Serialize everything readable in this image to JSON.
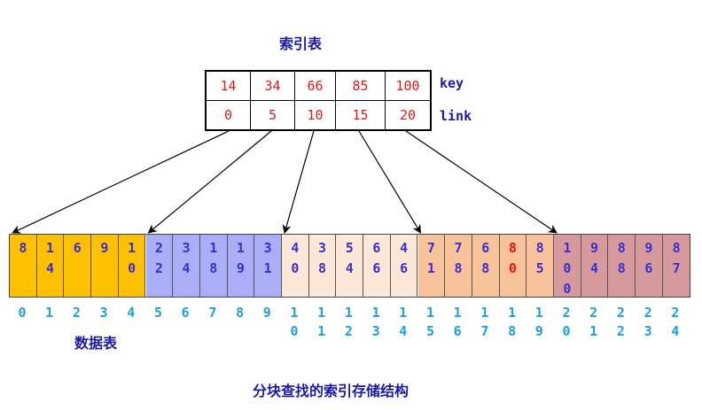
{
  "index_table": {
    "title": "索引表",
    "key_label": "key",
    "link_label": "link",
    "keys": [
      "14",
      "34",
      "66",
      "85",
      "100"
    ],
    "links": [
      "0",
      "5",
      "10",
      "15",
      "20"
    ]
  },
  "data_table": {
    "title": "数据表",
    "values": [
      "8",
      "14",
      "6",
      "9",
      "10",
      "22",
      "34",
      "18",
      "19",
      "31",
      "40",
      "38",
      "54",
      "66",
      "46",
      "71",
      "78",
      "68",
      "80",
      "85",
      "100",
      "94",
      "88",
      "96",
      "87"
    ],
    "positions": [
      "0",
      "1",
      "2",
      "3",
      "4",
      "5",
      "6",
      "7",
      "8",
      "9",
      "10",
      "11",
      "12",
      "13",
      "14",
      "15",
      "16",
      "17",
      "18",
      "19",
      "20",
      "21",
      "22",
      "23",
      "24"
    ],
    "highlighted_value": "80",
    "block_colors": [
      "#ffc000",
      "#a9aef7",
      "#fde7d6",
      "#f8c29a",
      "#d69a9c"
    ]
  },
  "caption": "分块查找的索引存储结构",
  "arrow_targets": [
    "0",
    "5",
    "10",
    "15",
    "20"
  ]
}
